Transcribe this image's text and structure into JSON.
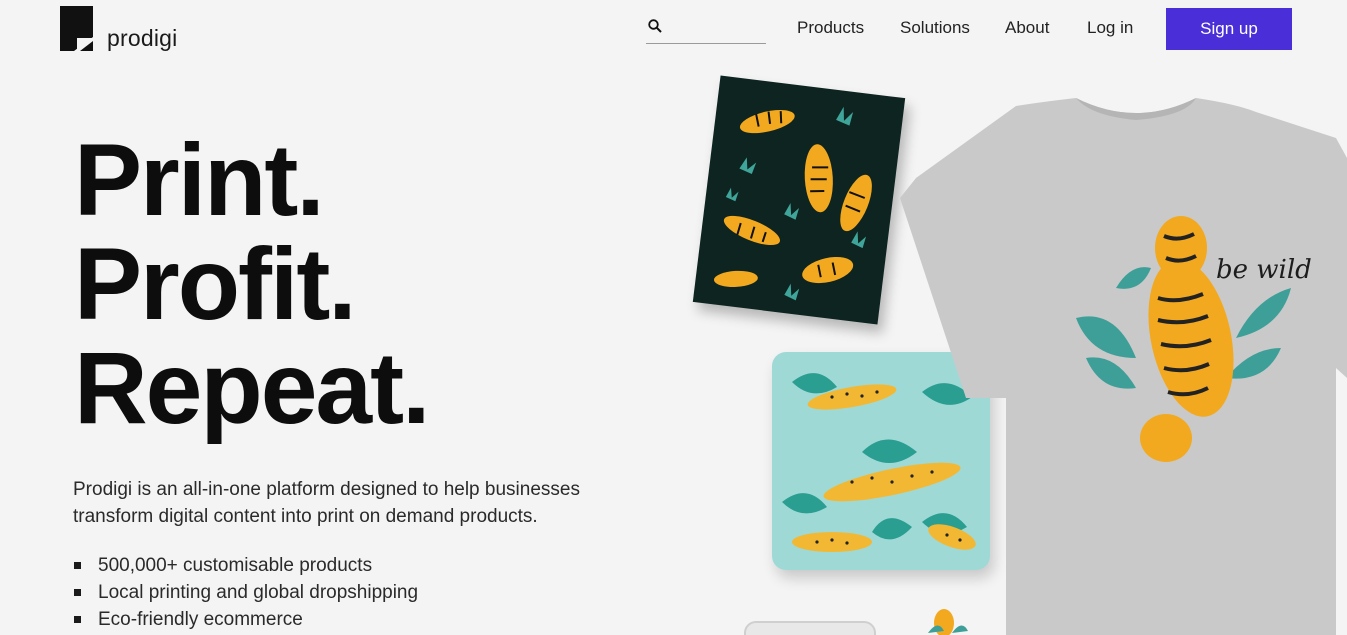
{
  "header": {
    "logo_text": "prodigi",
    "search": {
      "placeholder": "",
      "value": ""
    },
    "nav": {
      "products": "Products",
      "solutions": "Solutions",
      "about": "About",
      "login": "Log in",
      "signup": "Sign up"
    },
    "accent_color": "#4a2fd8"
  },
  "hero": {
    "title_lines": [
      "Print.",
      "Profit.",
      "Repeat."
    ],
    "description": "Prodigi is an all-in-one platform designed to help businesses transform digital content into print on demand products.",
    "features": [
      "500,000+ customisable products",
      "Local printing and global dropshipping",
      "Eco-friendly ecommerce"
    ]
  },
  "products": {
    "tshirt_print_text": "be wild"
  },
  "icons": [
    "logo-mark-icon",
    "search-icon"
  ]
}
